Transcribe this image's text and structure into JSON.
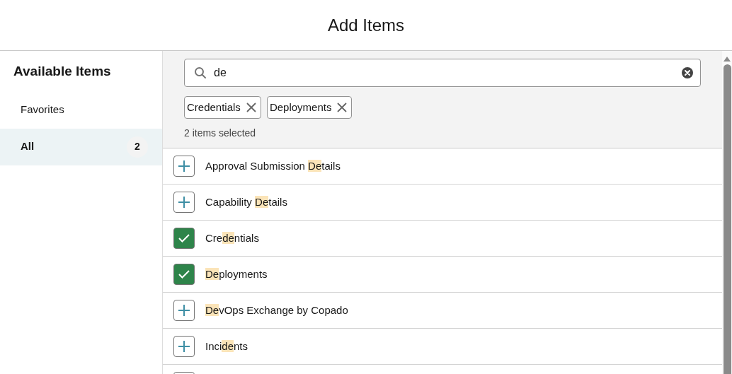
{
  "dialog": {
    "title": "Add Items"
  },
  "sidebar": {
    "heading": "Available Items",
    "items": [
      {
        "label": "Favorites",
        "selected": false
      },
      {
        "label": "All",
        "selected": true,
        "count": "2"
      }
    ]
  },
  "search": {
    "value": "de"
  },
  "pills": [
    {
      "label": "Credentials"
    },
    {
      "label": "Deployments"
    }
  ],
  "selection_summary": "2 items selected",
  "items": [
    {
      "selected": false,
      "parts": [
        {
          "text": "Approval Submission "
        },
        {
          "text": "De",
          "highlighted": true
        },
        {
          "text": "tails"
        }
      ]
    },
    {
      "selected": false,
      "parts": [
        {
          "text": "Capability "
        },
        {
          "text": "De",
          "highlighted": true
        },
        {
          "text": "tails"
        }
      ]
    },
    {
      "selected": true,
      "parts": [
        {
          "text": "Cre"
        },
        {
          "text": "de",
          "highlighted": true
        },
        {
          "text": "ntials"
        }
      ]
    },
    {
      "selected": true,
      "parts": [
        {
          "text": "De",
          "highlighted": true
        },
        {
          "text": "ployments"
        }
      ]
    },
    {
      "selected": false,
      "parts": [
        {
          "text": "De",
          "highlighted": true
        },
        {
          "text": "vOps Exchange by Copado"
        }
      ]
    },
    {
      "selected": false,
      "parts": [
        {
          "text": "Inci"
        },
        {
          "text": "de",
          "highlighted": true
        },
        {
          "text": "nts"
        }
      ]
    },
    {
      "selected": false
    }
  ]
}
